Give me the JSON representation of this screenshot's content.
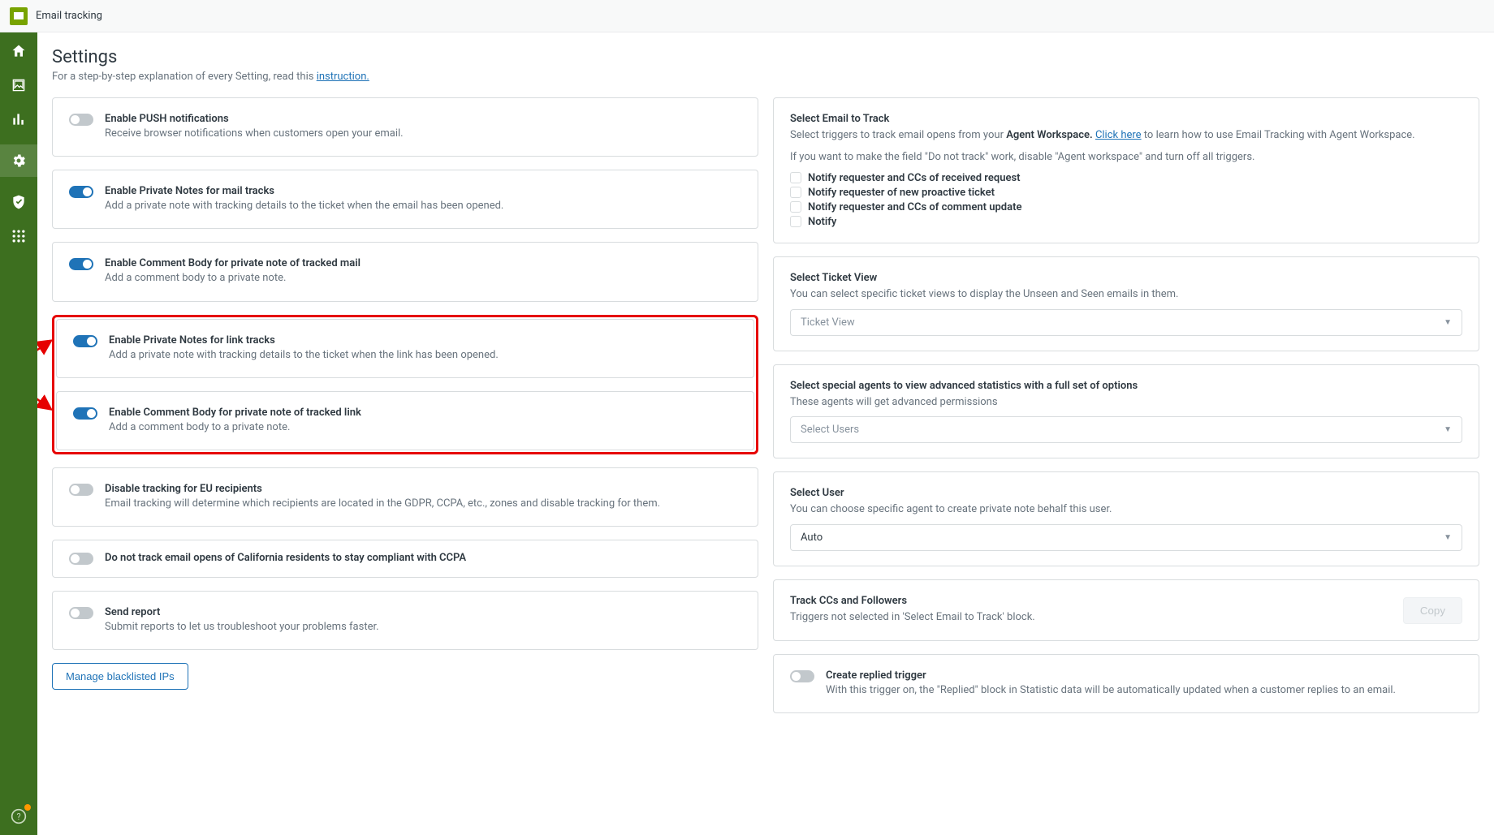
{
  "header": {
    "title": "Email tracking"
  },
  "page": {
    "title": "Settings",
    "subtitle_prefix": "For a step-by-step explanation of every Setting, read this ",
    "subtitle_link": "instruction."
  },
  "settings": [
    {
      "title": "Enable PUSH notifications",
      "desc": "Receive browser notifications when customers open your email.",
      "on": false
    },
    {
      "title": "Enable Private Notes for mail tracks",
      "desc": "Add a private note with tracking details to the ticket when the email has been opened.",
      "on": true
    },
    {
      "title": "Enable Comment Body for private note of tracked mail",
      "desc": "Add a comment body to a private note.",
      "on": true
    },
    {
      "title": "Enable Private Notes for link tracks",
      "desc": "Add a private note with tracking details to the ticket when the link has been opened.",
      "on": true
    },
    {
      "title": "Enable Comment Body for private note of tracked link",
      "desc": "Add a comment body to a private note.",
      "on": true
    },
    {
      "title": "Disable tracking for EU recipients",
      "desc": "Email tracking will determine which recipients are located in the GDPR, CCPA, etc., zones and disable tracking for them.",
      "on": false
    },
    {
      "title": "Do not track email opens of California residents to stay compliant with CCPA",
      "desc": "",
      "on": false
    },
    {
      "title": "Send report",
      "desc": "Submit reports to let us troubleshoot your problems faster.",
      "on": false
    }
  ],
  "manage_btn": "Manage blacklisted IPs",
  "right": {
    "select_email": {
      "title": "Select Email to Track",
      "desc_1a": "Select triggers to track email opens from your ",
      "desc_1b": "Agent Workspace. ",
      "desc_1c": "Click here",
      "desc_1d": " to learn how to use Email Tracking with Agent Workspace.",
      "desc_2": "If you want to make the field \"Do not track\" work, disable \"Agent workspace\" and turn off all triggers.",
      "checks": [
        "Notify requester and CCs of received request",
        "Notify requester of new proactive ticket",
        "Notify requester and CCs of comment update",
        "Notify"
      ]
    },
    "ticket_view": {
      "title": "Select Ticket View",
      "desc": "You can select specific ticket views to display the Unseen and Seen emails in them.",
      "placeholder": "Ticket View"
    },
    "special_agents": {
      "title": "Select special agents to view advanced statistics with a full set of options",
      "desc": "These agents will get advanced permissions",
      "placeholder": "Select Users"
    },
    "select_user": {
      "title": "Select User",
      "desc": "You can choose specific agent to create private note behalf this user.",
      "value": "Auto"
    },
    "track_cc": {
      "title": "Track CCs and Followers",
      "desc": "Triggers not selected in 'Select Email to Track' block.",
      "copy": "Copy"
    },
    "replied": {
      "title": "Create replied trigger",
      "desc": "With this trigger on, the \"Replied\" block in Statistic data will be automatically updated when a customer replies to an email."
    }
  }
}
